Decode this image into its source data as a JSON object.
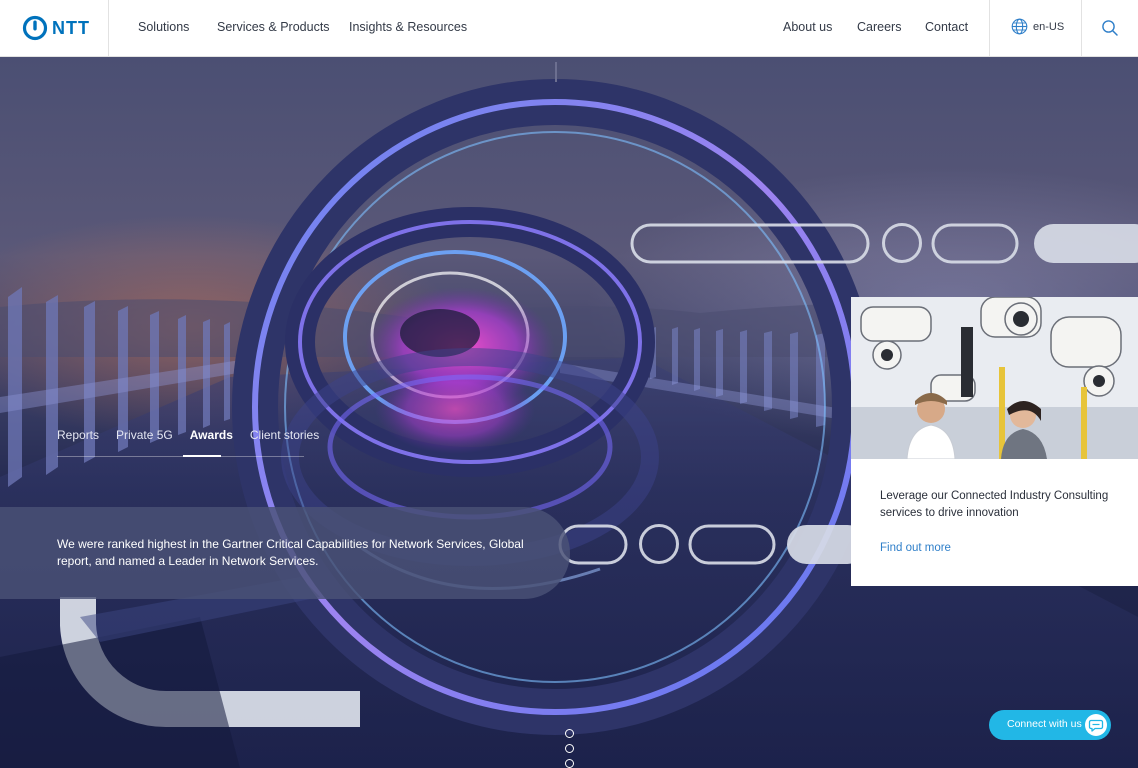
{
  "header": {
    "logo_text": "NTT",
    "nav_left": [
      "Solutions",
      "Services & Products",
      "Insights & Resources"
    ],
    "nav_right": [
      "About us",
      "Careers",
      "Contact"
    ],
    "language": "en-US"
  },
  "hero": {
    "tabs": [
      {
        "label": "Reports",
        "active": false
      },
      {
        "label": "Private 5G",
        "active": false
      },
      {
        "label": "Awards",
        "active": true
      },
      {
        "label": "Client stories",
        "active": false
      }
    ],
    "message": "We were ranked highest in the Gartner Critical Capabilities for Network Services, Global report, and named a Leader in Network Services."
  },
  "promo": {
    "text": "Leverage our Connected Industry Consulting services to drive innovation",
    "link": "Find out more"
  },
  "carousel": {
    "slide_count": 3,
    "active_index": 0
  },
  "chat": {
    "label": "Connect with us"
  },
  "colors": {
    "brand_blue": "#0072bc",
    "chat_cyan": "#22b7e6",
    "link_blue": "#2f7fc9"
  }
}
